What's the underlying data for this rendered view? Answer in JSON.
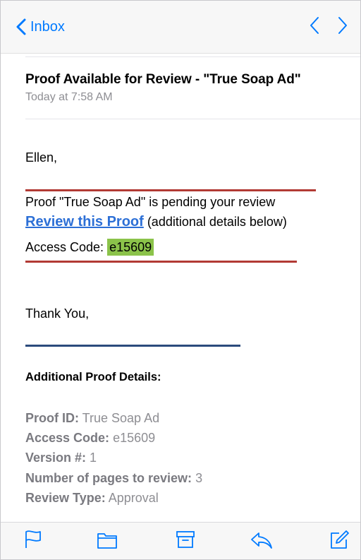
{
  "nav": {
    "back_label": "Inbox"
  },
  "email": {
    "subject": "Proof Available for Review - \"True Soap Ad\"",
    "date": "Today at 7:58 AM",
    "greeting": "Ellen,",
    "pending_line": "Proof \"True Soap Ad\" is pending your review",
    "review_link": "Review this Proof",
    "review_suffix": " (additional details below)",
    "access_code_label": "Access Code: ",
    "access_code_value": "e15609",
    "closing": "Thank You,",
    "details_title": "Additional Proof Details:",
    "details": [
      {
        "label": "Proof ID:",
        "value": " True Soap Ad"
      },
      {
        "label": "Access Code:",
        "value": " e15609"
      },
      {
        "label": "Version #:",
        "value": " 1"
      },
      {
        "label": "Number of pages to review:",
        "value": " 3"
      },
      {
        "label": "Review Type:",
        "value": " Approval"
      }
    ]
  },
  "colors": {
    "accent": "#007aff",
    "link": "#2c6fd6",
    "highlight": "#8bc34a",
    "red_rule": "#b23a34",
    "blue_rule": "#2b4a7c"
  },
  "toolbar": {
    "icons": [
      "flag-icon",
      "folder-icon",
      "archive-icon",
      "reply-icon",
      "compose-icon"
    ]
  }
}
